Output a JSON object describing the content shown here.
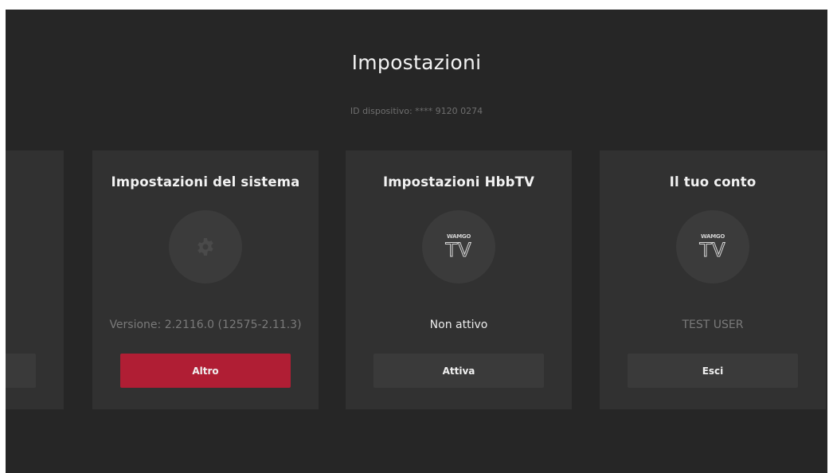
{
  "header": {
    "title": "Impostazioni",
    "device_id": "ID dispositivo: **** 9120 0274"
  },
  "cards": [
    {
      "title": "Impostazioni del sistema",
      "icon": "gear-icon",
      "status": "Versione: 2.2116.0 (12575-2.11.3)",
      "button": "Altro",
      "focused": true
    },
    {
      "title": "Impostazioni HbbTV",
      "icon": "wamgo-tv-logo",
      "logo_brand": "WAMGO",
      "logo_tv": "TV",
      "status": "Non attivo",
      "button": "Attiva",
      "focused": false
    },
    {
      "title": "Il tuo conto",
      "icon": "wamgo-tv-logo",
      "logo_brand": "WAMGO",
      "logo_tv": "TV",
      "status": "TEST USER",
      "button": "Esci",
      "focused": false
    }
  ],
  "colors": {
    "background": "#262626",
    "card": "#313131",
    "accent": "#b01e34",
    "button": "#3a3a3a"
  }
}
